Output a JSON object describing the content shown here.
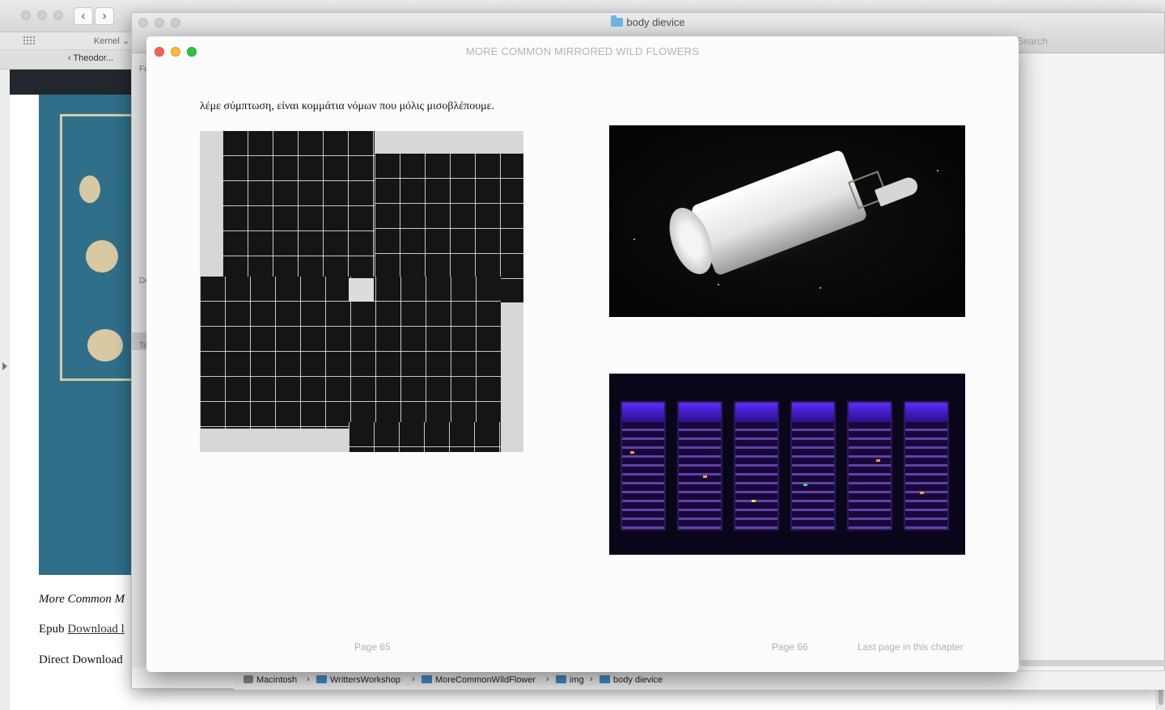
{
  "browser": {
    "kernel_label": "Kernel ⌄",
    "back_tab": "‹ Theodor...",
    "back_btn": "‹",
    "forward_btn": "›",
    "book_caption": "More Common M",
    "epub_label": "Epub",
    "epub_link": "Download l",
    "direct_download": "Direct Download"
  },
  "finder": {
    "title": "body dievice",
    "search_placeholder": "Search",
    "sidebar_letters": [
      "Fa",
      "De",
      "Ta"
    ],
    "path": [
      "Macintosh",
      "WrittersWorkshop",
      "MoreCommonWildFlower",
      "img",
      "body dievice"
    ],
    "path_sep": "›"
  },
  "book": {
    "window_title": "MORE COMMON MIRRORED WILD FLOWERS",
    "greek_text": "λέμε σύμπτωση, είναι κομμάτια νόμων που μόλις μισοβλέπουμε.",
    "page_left": "Page 65",
    "page_right": "Page 66",
    "last_page_note": "Last page in this chapter"
  },
  "colors": {
    "close": "#fc5f57",
    "minimize": "#fdbc2e",
    "zoom": "#28c840",
    "folder": "#3f8fd0"
  }
}
